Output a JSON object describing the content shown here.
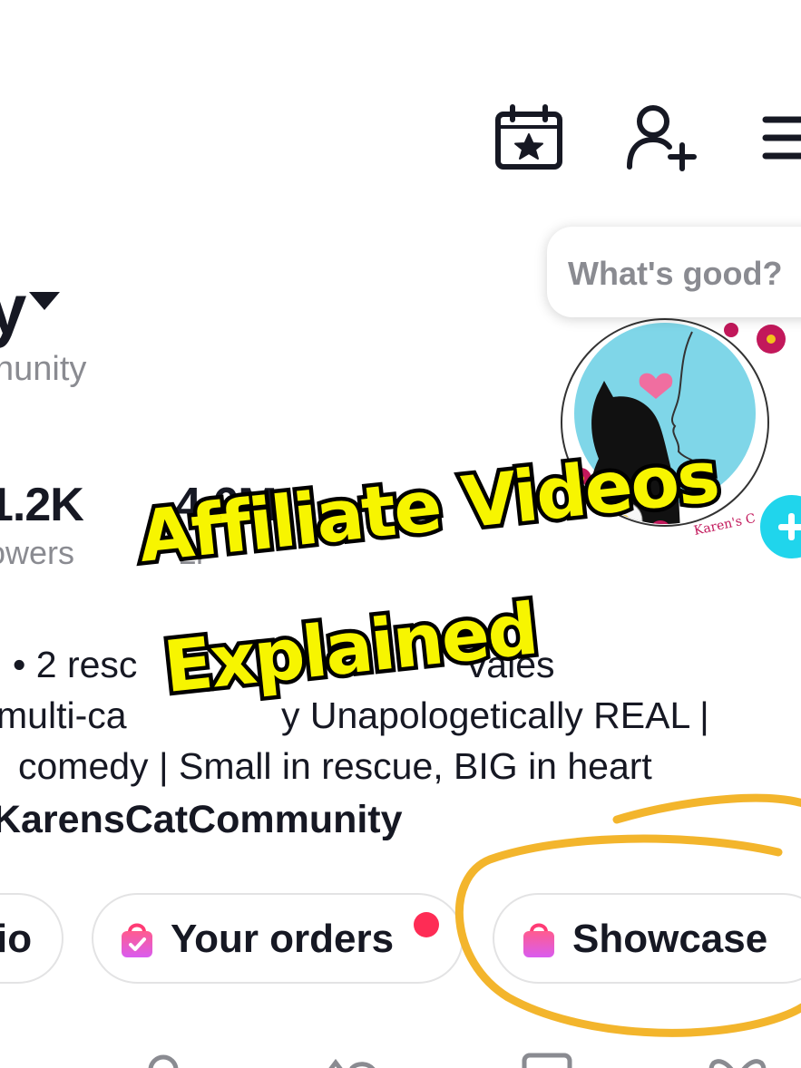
{
  "header": {
    "icons": [
      "calendar-star-icon",
      "add-friend-icon",
      "menu-icon"
    ]
  },
  "prompt_bubble": {
    "text": "What's good?"
  },
  "profile": {
    "name_fragment": "y",
    "subname_fragment": "nunity"
  },
  "stats": [
    {
      "value": "1.2K",
      "label": "owers"
    },
    {
      "value": "4.6M",
      "label": "Li"
    }
  ],
  "bio": {
    "lines": [
      "• 2 resc",
      "Vales",
      "multi-ca",
      "y  Unapologetically REAL |",
      "comedy | Small in rescue, BIG in heart"
    ],
    "link": "/KarensCatCommunity"
  },
  "buttons": {
    "studio_fragment": "io",
    "orders_label": "Your orders",
    "showcase_label": "Showcase"
  },
  "overlay_caption": {
    "line1": "Affiliate Videos",
    "line2": "Explained"
  },
  "colors": {
    "caption_fill": "#f7f500",
    "caption_stroke": "#000000",
    "annotation": "#f3b52c",
    "notification_dot": "#fe2c55",
    "follow_plus": "#20d5ec",
    "bag_gradient_top": "#ff5b8f",
    "bag_gradient_bottom": "#d95cf0",
    "muted_text": "#8a8b91"
  }
}
